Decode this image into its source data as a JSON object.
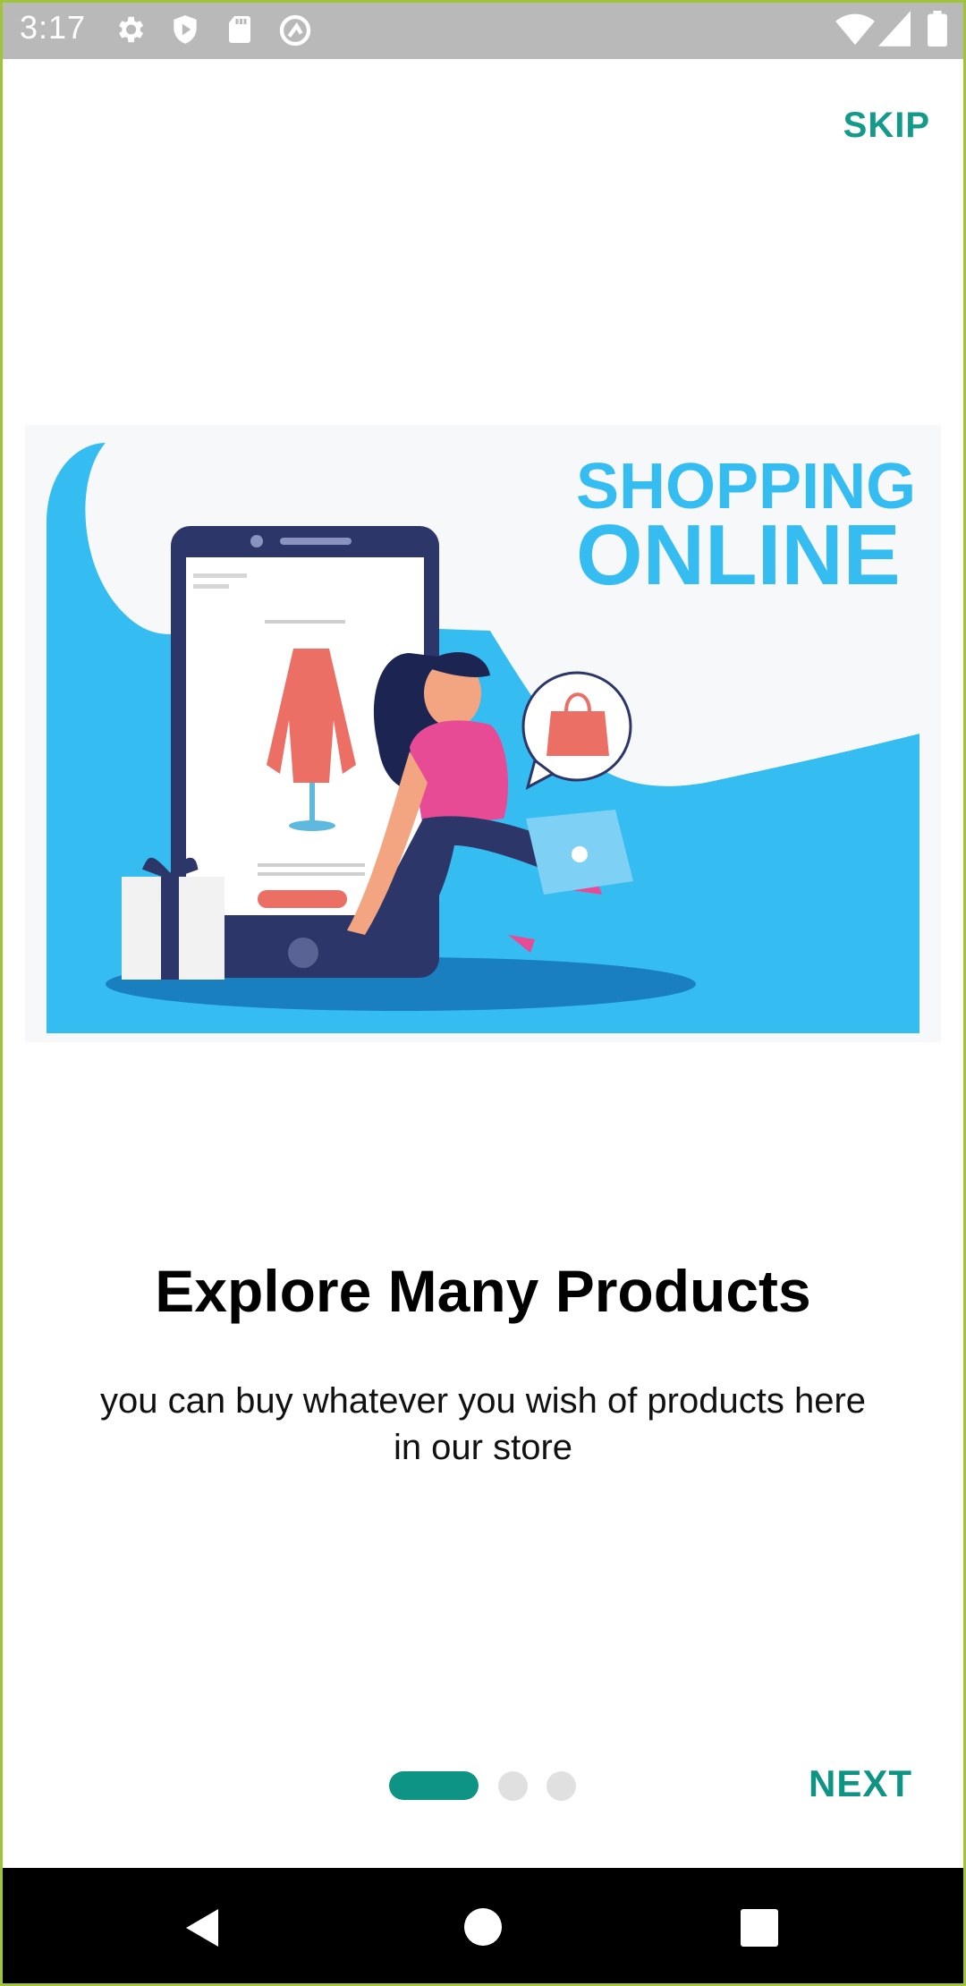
{
  "status_bar": {
    "time": "3:17",
    "icons_left": [
      "settings-gear-icon",
      "play-shield-icon",
      "sd-card-icon",
      "at-sign-icon"
    ],
    "icons_right": [
      "wifi-icon",
      "signal-icon",
      "battery-icon"
    ]
  },
  "header": {
    "skip_label": "SKIP"
  },
  "illustration": {
    "headline_line1": "SHOPPING",
    "headline_line2": "ONLINE",
    "accent_color": "#35bdf2"
  },
  "onboarding": {
    "title": "Explore Many Products",
    "description": "you can buy whatever you wish of products here in our store",
    "page_indicator": {
      "current": 1,
      "total": 3
    }
  },
  "footer": {
    "next_label": "NEXT"
  },
  "colors": {
    "primary": "#0e9484",
    "status_bar": "#b9b9b9",
    "nav_bar": "#000000"
  },
  "nav_bar": {
    "buttons": [
      "back-icon",
      "home-icon",
      "recents-icon"
    ]
  }
}
